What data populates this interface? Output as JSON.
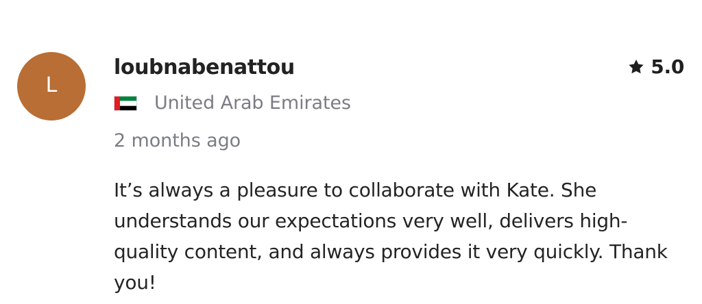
{
  "review": {
    "avatar_initial": "L",
    "avatar_color": "#b86e34",
    "username": "loubnabenattou",
    "rating": {
      "icon": "star-icon",
      "value": "5.0"
    },
    "country": {
      "flag_icon": "uae-flag-icon",
      "name": "United Arab Emirates"
    },
    "timestamp": "2 months ago",
    "text": "It’s always a pleasure to collaborate with Kate. She understands our expectations very well, delivers high-quality content, and always provides it very quickly. Thank you!"
  }
}
